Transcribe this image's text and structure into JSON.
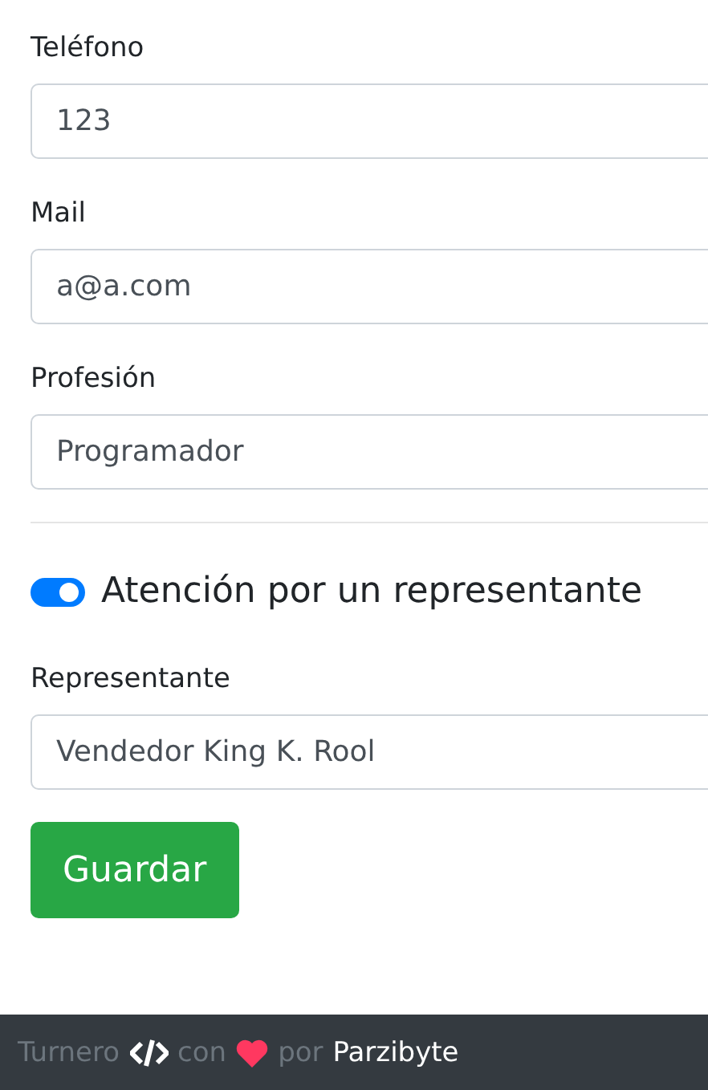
{
  "fields": [
    {
      "label": "Teléfono",
      "value": "123"
    },
    {
      "label": "Mail",
      "value": "a@a.com"
    },
    {
      "label": "Profesión",
      "value": "Programador"
    }
  ],
  "switch": {
    "label": "Atención por un representante",
    "on": true
  },
  "representative": {
    "label": "Representante",
    "value": "Vendedor King K. Rool"
  },
  "save_button": "Guardar",
  "footer": {
    "text_1": "Turnero",
    "text_2": "con",
    "text_3": "por",
    "link": "Parzibyte"
  }
}
